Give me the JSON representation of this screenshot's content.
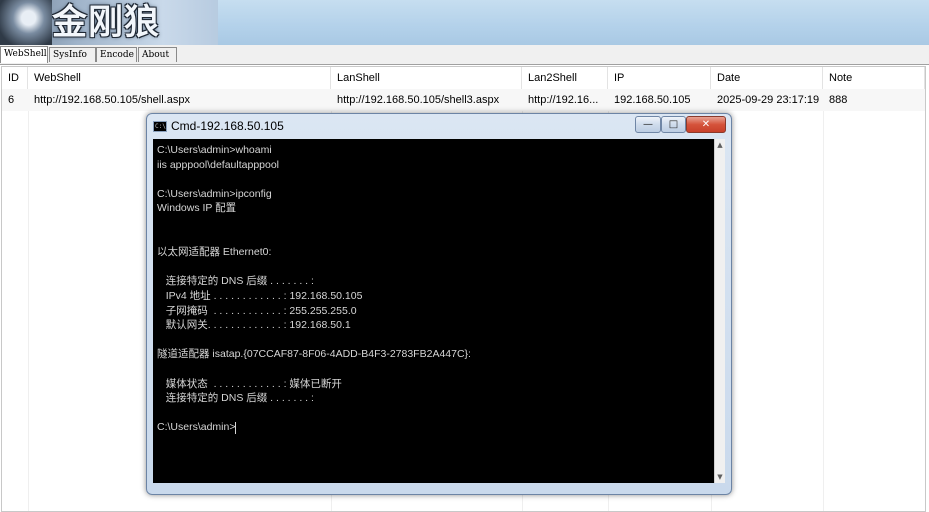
{
  "banner": {
    "title": "金刚狼"
  },
  "tabs": [
    "WebShell",
    "SysInfo",
    "Encode",
    "About"
  ],
  "table": {
    "columns": [
      "ID",
      "WebShell",
      "LanShell",
      "Lan2Shell",
      "IP",
      "Date",
      "Note"
    ],
    "rows": [
      [
        "6",
        "http://192.168.50.105/shell.aspx",
        "http://192.168.50.105/shell3.aspx",
        "http://192.16...",
        "192.168.50.105",
        "2025-09-29 23:17:19",
        "888"
      ]
    ]
  },
  "cmd": {
    "title": "Cmd-192.168.50.105",
    "icon": "console-icon",
    "controls": [
      "minimize-icon",
      "maximize-icon",
      "close-icon"
    ],
    "lines": [
      "C:\\Users\\admin>whoami",
      "iis apppool\\defaultapppool",
      "",
      "C:\\Users\\admin>ipconfig",
      "Windows IP 配置",
      "",
      "",
      "以太网适配器 Ethernet0:",
      "",
      "   连接特定的 DNS 后缀 . . . . . . . :",
      "   IPv4 地址 . . . . . . . . . . . . : 192.168.50.105",
      "   子网掩码  . . . . . . . . . . . . : 255.255.255.0",
      "   默认网关. . . . . . . . . . . . . : 192.168.50.1",
      "",
      "隧道适配器 isatap.{07CCAF87-8F06-4ADD-B4F3-2783FB2A447C}:",
      "",
      "   媒体状态  . . . . . . . . . . . . : 媒体已断开",
      "   连接特定的 DNS 后缀 . . . . . . . :",
      "",
      "C:\\Users\\admin>"
    ]
  }
}
